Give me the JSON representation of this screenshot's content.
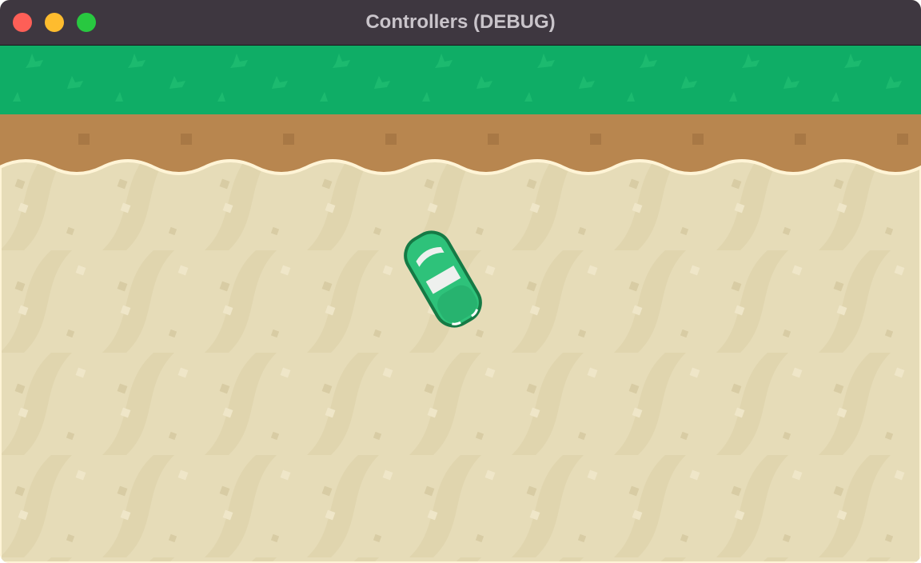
{
  "window": {
    "title": "Controllers (DEBUG)",
    "buttons": {
      "close_color": "#fe5f57",
      "minimize_color": "#febc2e",
      "maximize_color": "#28c840"
    }
  },
  "scene": {
    "terrain": [
      "grass",
      "dirt",
      "sand"
    ],
    "colors": {
      "grass": "#0fad66",
      "dirt": "#b8864f",
      "sand": "#e6dcb8",
      "car": "#2ec27a",
      "car_outline": "#157a45"
    },
    "player": {
      "sprite": "green-car"
    }
  }
}
